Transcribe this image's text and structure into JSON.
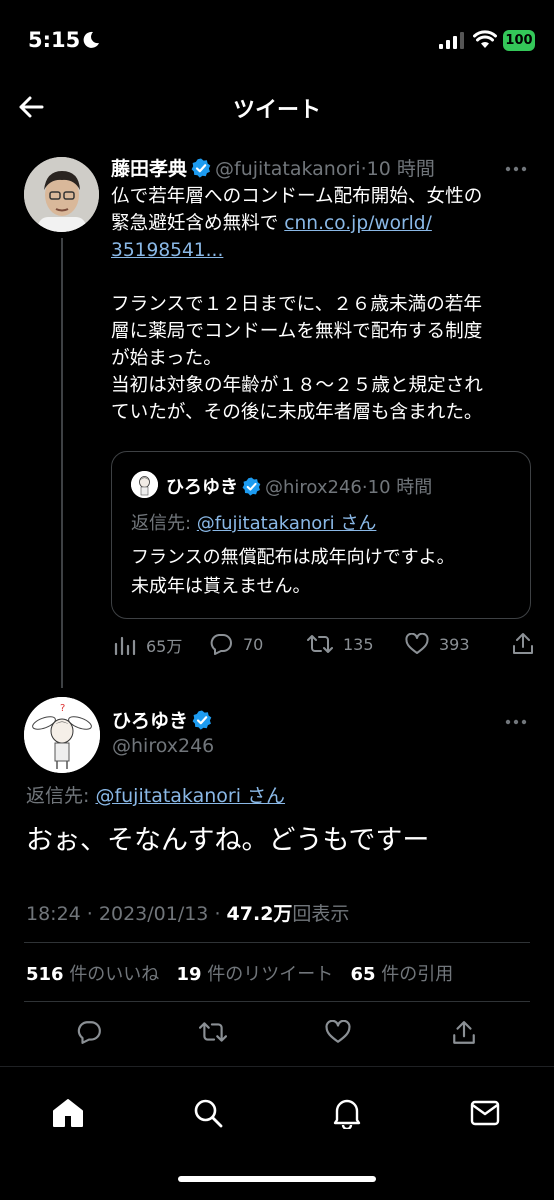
{
  "status_bar": {
    "time": "5:15",
    "battery": "100"
  },
  "header": {
    "title": "ツイート"
  },
  "tweet1": {
    "name": "藤田孝典",
    "handle": "@fujitatakanori",
    "sep": "·",
    "time": "10 時間",
    "text_line1": "仏で若年層へのコンドーム配布開始、女性の",
    "text_line2": "緊急避妊含め無料で",
    "link_part1": "cnn.co.jp/world/",
    "link_part2": "35198541...",
    "para2_line1": "フランスで１２日までに、２６歳未満の若年",
    "para2_line2": "層に薬局でコンドームを無料で配布する制度",
    "para2_line3": "が始まった。",
    "para2_line4": "当初は対象の年齢が１８〜２５歳と規定され",
    "para2_line5": "ていたが、その後に未成年者層も含まれた。",
    "quote": {
      "name": "ひろゆき",
      "handle": "@hirox246",
      "sep": "·",
      "time": "10 時間",
      "reply_label": "返信先: ",
      "reply_to": "@fujitatakanori さん",
      "text_line1": "フランスの無償配布は成年向けですよ。",
      "text_line2": "未成年は貰えません。"
    },
    "views": "65万",
    "replies": "70",
    "retweets": "135",
    "likes": "393"
  },
  "tweet2": {
    "name": "ひろゆき",
    "handle": "@hirox246",
    "reply_label": "返信先: ",
    "reply_to": "@fujitatakanori さん",
    "text": "おぉ、そなんすね。どうもですー",
    "time": "18:24",
    "sep1": " · ",
    "date": "2023/01/13",
    "sep2": " · ",
    "views_count": "47.2万",
    "views_label": "回表示",
    "likes_count": "516",
    "likes_label": "件のいいね",
    "retweets_count": "19",
    "retweets_label": "件のリツイート",
    "quotes_count": "65",
    "quotes_label": "件の引用"
  },
  "colors": {
    "background": "#000000",
    "accent": "#1d9bf0",
    "muted": "#71767b",
    "divider": "#2f3336"
  }
}
